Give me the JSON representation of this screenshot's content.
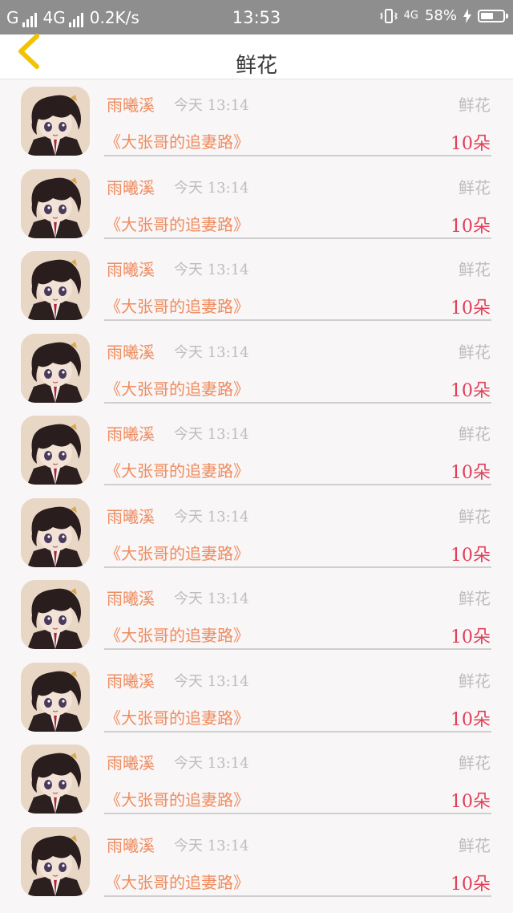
{
  "status_bar": {
    "network": "G",
    "network2": "4G",
    "speed": "0.2K/s",
    "time": "13:53",
    "data_badge": "4G",
    "battery": "58%",
    "battery_level": 0.58
  },
  "header": {
    "back_icon": "chevron-left-icon",
    "title": "鲜花"
  },
  "accent_colors": {
    "name": "#ef8c5f",
    "count": "#e0405a",
    "muted": "#bdbdbd",
    "back": "#f2c300"
  },
  "records": [
    {
      "user": "雨曦溪",
      "time": "今天 13:14",
      "gift": "鲜花",
      "book": "《大张哥的追妻路》",
      "count": "10朵"
    },
    {
      "user": "雨曦溪",
      "time": "今天 13:14",
      "gift": "鲜花",
      "book": "《大张哥的追妻路》",
      "count": "10朵"
    },
    {
      "user": "雨曦溪",
      "time": "今天 13:14",
      "gift": "鲜花",
      "book": "《大张哥的追妻路》",
      "count": "10朵"
    },
    {
      "user": "雨曦溪",
      "time": "今天 13:14",
      "gift": "鲜花",
      "book": "《大张哥的追妻路》",
      "count": "10朵"
    },
    {
      "user": "雨曦溪",
      "time": "今天 13:14",
      "gift": "鲜花",
      "book": "《大张哥的追妻路》",
      "count": "10朵"
    },
    {
      "user": "雨曦溪",
      "time": "今天 13:14",
      "gift": "鲜花",
      "book": "《大张哥的追妻路》",
      "count": "10朵"
    },
    {
      "user": "雨曦溪",
      "time": "今天 13:14",
      "gift": "鲜花",
      "book": "《大张哥的追妻路》",
      "count": "10朵"
    },
    {
      "user": "雨曦溪",
      "time": "今天 13:14",
      "gift": "鲜花",
      "book": "《大张哥的追妻路》",
      "count": "10朵"
    },
    {
      "user": "雨曦溪",
      "time": "今天 13:14",
      "gift": "鲜花",
      "book": "《大张哥的追妻路》",
      "count": "10朵"
    },
    {
      "user": "雨曦溪",
      "time": "今天 13:14",
      "gift": "鲜花",
      "book": "《大张哥的追妻路》",
      "count": "10朵"
    }
  ]
}
